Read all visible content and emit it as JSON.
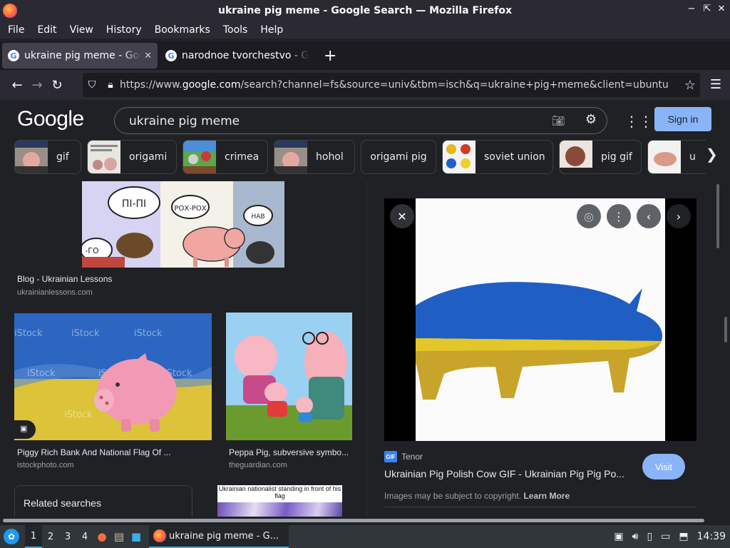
{
  "window": {
    "title": "ukraine pig meme - Google Search — Mozilla Firefox",
    "min": "−",
    "restore": "⇱",
    "close": "✕"
  },
  "menu": [
    "File",
    "Edit",
    "View",
    "History",
    "Bookmarks",
    "Tools",
    "Help"
  ],
  "tabs": [
    {
      "label": "ukraine pig meme - Google Search",
      "active": true
    },
    {
      "label": "narodnoe tvorchestvo - Google Search",
      "active": false
    }
  ],
  "nav": {
    "url_prefix": "https://www.",
    "url_host": "google.com",
    "url_rest": "/search?channel=fs&source=univ&tbm=isch&q=ukraine+pig+meme&client=ubuntu"
  },
  "google": {
    "logo": "Google",
    "query": "ukraine pig meme",
    "sign_in": "Sign in",
    "chips": [
      "gif",
      "origami",
      "crimea",
      "hohol",
      "origami pig",
      "soviet union",
      "pig gif",
      "u"
    ]
  },
  "results": [
    {
      "title": "Blog - Ukrainian Lessons",
      "site": "ukrainianlessons.com",
      "bubbles": [
        "ПІ-ПІ",
        "РОХ-РОХ",
        "НАВ",
        "-ГО"
      ]
    },
    {
      "title": "Piggy Rich Bank And National Flag Of ...",
      "site": "istockphoto.com",
      "watermark": "iStock"
    },
    {
      "title": "Peppa Pig, subversive symbo...",
      "site": "theguardian.com"
    },
    {
      "caption": "Ukrainian nationalist standing in front of his flag"
    }
  ],
  "related": "Related searches",
  "preview": {
    "source": "Tenor",
    "source_badge": "GIF",
    "title": "Ukrainian Pig Polish Cow GIF - Ukrainian Pig Pig Po...",
    "visit": "Visit",
    "copyright": "Images may be subject to copyright.",
    "learn_more": "Learn More"
  },
  "taskbar": {
    "workspaces": [
      "1",
      "2",
      "3",
      "4"
    ],
    "task_label": "ukraine pig meme - G...",
    "clock": "14:39"
  },
  "colors": {
    "accent": "#8ab4f8",
    "ua_blue": "#1f5fc4",
    "ua_yellow": "#e2c62a"
  }
}
